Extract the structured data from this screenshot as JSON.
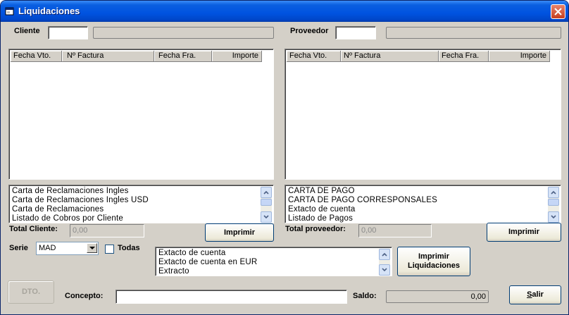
{
  "window": {
    "title": "Liquidaciones",
    "close_label": "✕"
  },
  "left": {
    "cliente_label": "Cliente",
    "cliente_code": "",
    "cliente_name": "",
    "columns": [
      "Fecha Vto.",
      "Nº Factura",
      "Fecha Fra.",
      "Importe"
    ],
    "reports": [
      "Carta de Reclamaciones Ingles",
      "Carta de Reclamaciones Ingles USD",
      "Carta de Reclamaciones",
      "Listado de Cobros por Cliente"
    ],
    "total_label": "Total Cliente:",
    "total_value": "0,00",
    "print_label": "Imprimir"
  },
  "right": {
    "proveedor_label": "Proveedor",
    "proveedor_code": "",
    "proveedor_name": "",
    "columns": [
      "Fecha Vto.",
      "Nº Factura",
      "Fecha Fra.",
      "Importe"
    ],
    "reports": [
      "CARTA DE PAGO",
      "CARTA DE PAGO CORRESPONSALES",
      "Extacto de cuenta",
      "Listado de Pagos"
    ],
    "total_label": "Total proveedor:",
    "total_value": "0,00",
    "print_label": "Imprimir"
  },
  "bottom": {
    "serie_label": "Serie",
    "serie_value": "MAD",
    "todas_label": "Todas",
    "liq_reports": [
      "Extacto de cuenta",
      "Extacto de cuenta en EUR",
      "Extracto"
    ],
    "print_liq_line1": "Imprimir",
    "print_liq_line2": "Liquidaciones",
    "dto_label": "DTO.",
    "concepto_label": "Concepto:",
    "concepto_value": "",
    "saldo_label": "Saldo:",
    "saldo_value": "0,00",
    "salir_first": "S",
    "salir_rest": "alir"
  },
  "colors": {
    "titlebar": "#0053e0",
    "face": "#d4d0c8"
  }
}
